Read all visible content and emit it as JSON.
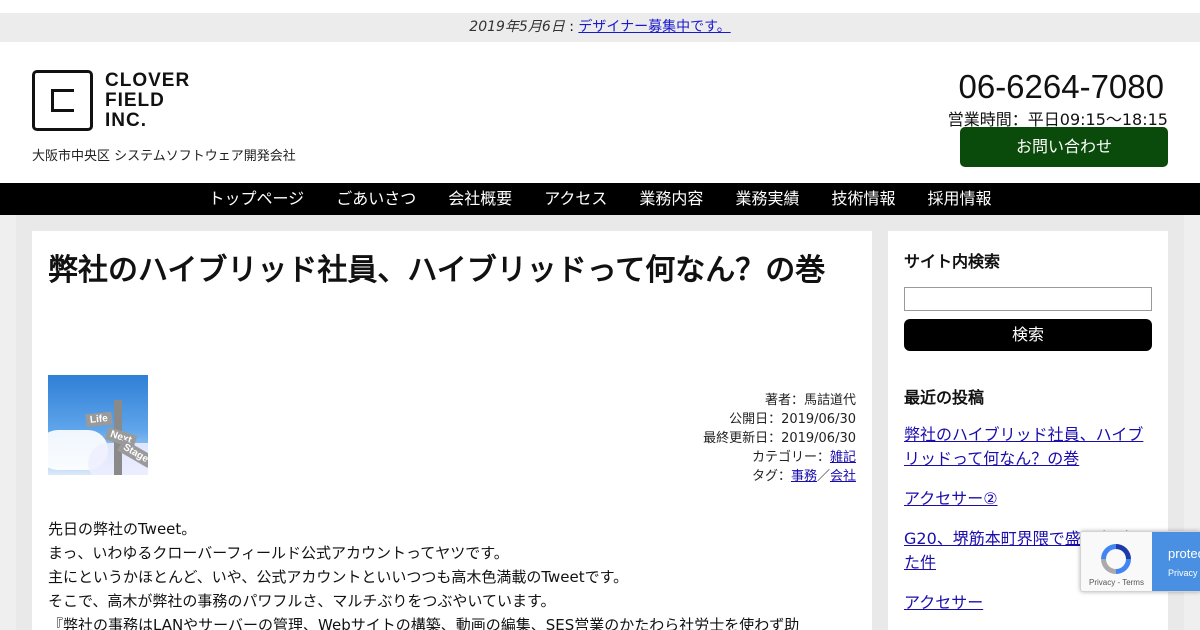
{
  "notice": {
    "date": "2019年5月6日",
    "separator": " : ",
    "link": "デザイナー募集中です。"
  },
  "header": {
    "logo_lines": [
      "CLOVER",
      "FIELD",
      "INC."
    ],
    "tagline": "大阪市中央区 システムソフトウェア開発会社",
    "phone": "06-6264-7080",
    "hours": "営業時間：平日09:15〜18:15",
    "contact_button": "お問い合わせ",
    "contact_color": "#0a4a0a"
  },
  "nav": {
    "items": [
      "トップページ",
      "ごあいさつ",
      "会社概要",
      "アクセス",
      "業務内容",
      "業務実績",
      "技術情報",
      "採用情報"
    ]
  },
  "article": {
    "title": "弊社のハイブリッド社員、ハイブリッドって何なん？の巻",
    "thumbnail_icon": "road-sign-life-next-stage-image",
    "thumbnail_signs": [
      "Life",
      "Next",
      "Stage"
    ],
    "meta": {
      "author": "著者：馬詰道代",
      "published": "公開日：2019/06/30",
      "updated": "最終更新日：2019/06/30",
      "category_label": "カテゴリー：",
      "category": "雑記",
      "tag_label": "タグ：",
      "tags": [
        "事務",
        "会社"
      ],
      "tag_sep": "／"
    },
    "paragraphs": [
      "先日の弊社のTweet。",
      "まっ、いわゆるクローバーフィールド公式アカウントってヤツです。",
      "主にというかほとんど、いや、公式アカウントといいつつも高木色満載のTweetです。",
      "そこで、高木が弊社の事務のパワフルさ、マルチぶりをつぶやいています。",
      "『弊社の事務はLANやサーバーの管理、Webサイトの構築、動画の編集、SES営業のかたわら社労士を使わず助"
    ]
  },
  "sidebar": {
    "search_heading": "サイト内検索",
    "search_value": "",
    "search_button": "検索",
    "recent_heading": "最近の投稿",
    "recent_posts": [
      "弊社のハイブリッド社員、ハイブリッドって何なん？の巻",
      "アクセサー②",
      "G20、堺筋本町界隈で盛り上がった件",
      "アクセサー"
    ]
  },
  "recaptcha": {
    "links": "Privacy - Terms",
    "label": "protected",
    "sub": "Privacy"
  }
}
